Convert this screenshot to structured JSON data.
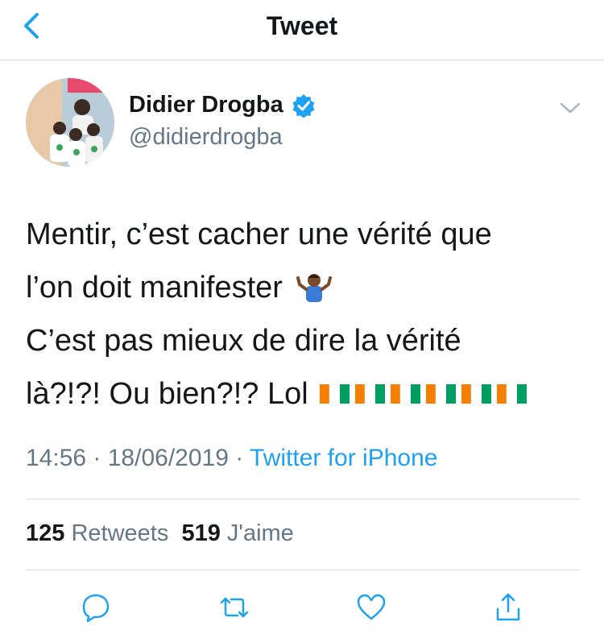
{
  "header": {
    "title": "Tweet",
    "back_icon": "chevron-left-icon"
  },
  "author": {
    "name": "Didier Drogba",
    "handle": "@didierdrogba",
    "verified_icon": "verified-badge-icon"
  },
  "tweet": {
    "lines": [
      "Mentir, c’est cacher une vérité que",
      "l’on doit manifester",
      "C’est pas mieux de dire la vérité",
      "là?!?! Ou bien?!? Lol"
    ],
    "emoji": "man-shrugging",
    "flags": [
      "ci-flag",
      "ci-flag",
      "ci-flag",
      "ci-flag",
      "ci-flag",
      "ci-flag"
    ]
  },
  "meta": {
    "time": "14:56",
    "sep1": " · ",
    "date": "18/06/2019",
    "sep2": " · ",
    "source": "Twitter for iPhone"
  },
  "stats": {
    "retweets_count": "125",
    "retweets_label": "Retweets",
    "likes_count": "519",
    "likes_label": "J'aime"
  },
  "colors": {
    "accent": "#1da1f2",
    "muted": "#657786",
    "text": "#14171a",
    "flag_orange": "#f77f00",
    "flag_green": "#009e60"
  }
}
